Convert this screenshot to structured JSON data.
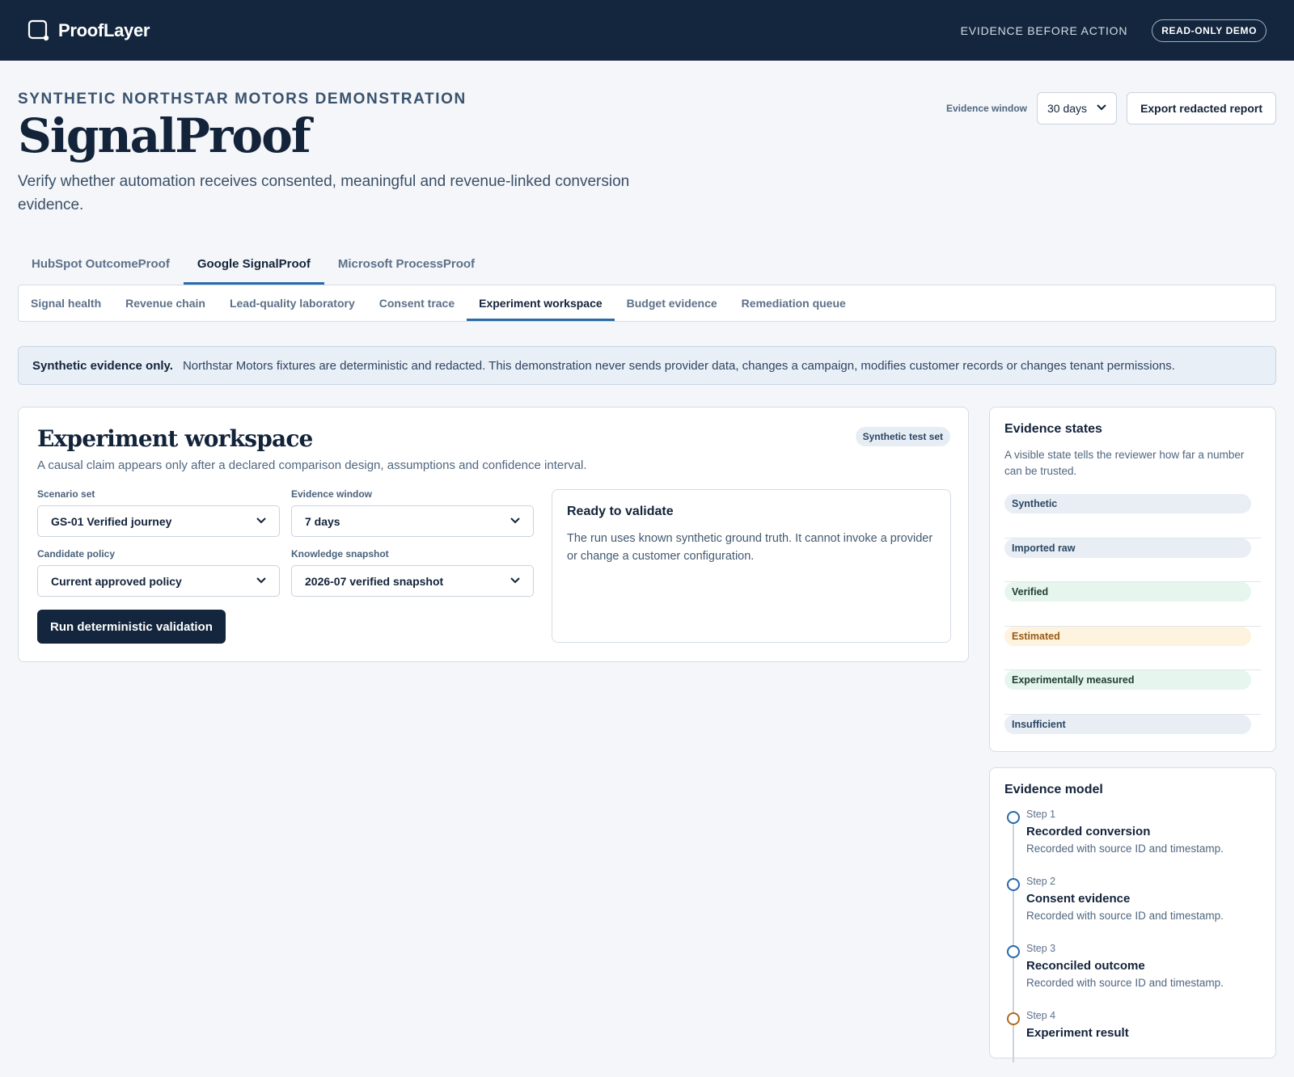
{
  "app": {
    "brand": "ProofLayer",
    "tagline": "EVIDENCE BEFORE ACTION",
    "mode_badge": "READ-ONLY DEMO"
  },
  "header": {
    "eyebrow": "SYNTHETIC NORTHSTAR MOTORS DEMONSTRATION",
    "title": "SignalProof",
    "subtitle": "Verify whether automation receives consented, meaningful and revenue-linked conversion evidence.",
    "evidence_window_label": "Evidence window",
    "evidence_window_value": "30 days",
    "export_label": "Export redacted report"
  },
  "product_tabs": [
    {
      "label": "HubSpot OutcomeProof",
      "active": false
    },
    {
      "label": "Google SignalProof",
      "active": true
    },
    {
      "label": "Microsoft ProcessProof",
      "active": false
    }
  ],
  "sub_tabs": [
    {
      "label": "Signal health",
      "active": false
    },
    {
      "label": "Revenue chain",
      "active": false
    },
    {
      "label": "Lead-quality laboratory",
      "active": false
    },
    {
      "label": "Consent trace",
      "active": false
    },
    {
      "label": "Experiment workspace",
      "active": true
    },
    {
      "label": "Budget evidence",
      "active": false
    },
    {
      "label": "Remediation queue",
      "active": false
    }
  ],
  "notice": {
    "strong": "Synthetic evidence only.",
    "text": "Northstar Motors fixtures are deterministic and redacted. This demonstration never sends provider data, changes a campaign, modifies customer records or changes tenant permissions."
  },
  "workspace": {
    "title": "Experiment workspace",
    "description": "A causal claim appears only after a declared comparison design, assumptions and confidence interval.",
    "badge": "Synthetic test set",
    "fields": {
      "scenario": {
        "label": "Scenario set",
        "value": "GS-01 Verified journey"
      },
      "window": {
        "label": "Evidence window",
        "value": "7 days"
      },
      "policy": {
        "label": "Candidate policy",
        "value": "Current approved policy"
      },
      "snapshot": {
        "label": "Knowledge snapshot",
        "value": "2026-07 verified snapshot"
      }
    },
    "run_label": "Run deterministic validation",
    "ready": {
      "title": "Ready to validate",
      "text": "The run uses known synthetic ground truth. It cannot invoke a provider or change a customer configuration."
    }
  },
  "evidence_states": {
    "title": "Evidence states",
    "description": "A visible state tells the reviewer how far a number can be trusted.",
    "items": [
      {
        "label": "Synthetic",
        "bg": "#e9eef5",
        "fg": "#2a4663"
      },
      {
        "label": "Imported raw",
        "bg": "#e9eef5",
        "fg": "#2a4663"
      },
      {
        "label": "Verified",
        "bg": "#e6f6ee",
        "fg": "#1f3d33"
      },
      {
        "label": "Estimated",
        "bg": "#fdf3df",
        "fg": "#9a5a16"
      },
      {
        "label": "Experimentally measured",
        "bg": "#e6f6ee",
        "fg": "#1f3d33"
      },
      {
        "label": "Insufficient",
        "bg": "#e9eef5",
        "fg": "#2a4663"
      }
    ]
  },
  "evidence_model": {
    "title": "Evidence model",
    "steps": [
      {
        "num": "Step 1",
        "name": "Recorded conversion",
        "desc": "Recorded with source ID and timestamp."
      },
      {
        "num": "Step 2",
        "name": "Consent evidence",
        "desc": "Recorded with source ID and timestamp."
      },
      {
        "num": "Step 3",
        "name": "Reconciled outcome",
        "desc": "Recorded with source ID and timestamp."
      },
      {
        "num": "Step 4",
        "name": "Experiment result",
        "desc": ""
      }
    ]
  },
  "colors": {
    "topbar": "#13263d",
    "accent": "#2b6aa8",
    "warning": "#b06a1f"
  }
}
